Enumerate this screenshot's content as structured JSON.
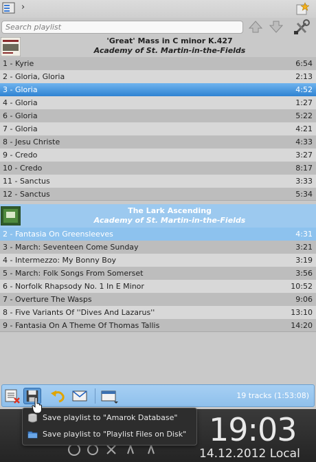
{
  "search": {
    "placeholder": "Search playlist"
  },
  "albums": [
    {
      "title": "'Great' Mass in C minor K.427",
      "artist": "Academy of St. Martin-in-the-Fields",
      "tracks": [
        {
          "name": "1 - Kyrie",
          "time": "6:54"
        },
        {
          "name": "2 - Gloria, Gloria",
          "time": "2:13"
        },
        {
          "name": "3 - Gloria",
          "time": "4:52"
        },
        {
          "name": "4 - Gloria",
          "time": "1:27"
        },
        {
          "name": "6 - Gloria",
          "time": "5:22"
        },
        {
          "name": "7 - Gloria",
          "time": "4:21"
        },
        {
          "name": "8 - Jesu Christe",
          "time": "4:33"
        },
        {
          "name": "9 - Credo",
          "time": "3:27"
        },
        {
          "name": "10 - Credo",
          "time": "8:17"
        },
        {
          "name": "11 - Sanctus",
          "time": "3:33"
        },
        {
          "name": "12 - Sanctus",
          "time": "5:34"
        }
      ]
    },
    {
      "title": "The Lark Ascending",
      "artist": "Academy of St. Martin-in-the-Fields",
      "tracks": [
        {
          "name": "2 - Fantasia On Greensleeves",
          "time": "4:31"
        },
        {
          "name": "3 - March: Seventeen Come Sunday",
          "time": "3:21"
        },
        {
          "name": "4 - Intermezzo: My Bonny Boy",
          "time": "3:19"
        },
        {
          "name": "5 - March: Folk Songs From Somerset",
          "time": "3:56"
        },
        {
          "name": "6 - Norfolk Rhapsody No. 1 In E Minor",
          "time": "10:52"
        },
        {
          "name": "7 - Overture The Wasps",
          "time": "9:06"
        },
        {
          "name": "8 - Five Variants Of ''Dives And Lazarus''",
          "time": "13:10"
        },
        {
          "name": "9 - Fantasia On A Theme Of Thomas Tallis",
          "time": "14:20"
        }
      ]
    }
  ],
  "status": {
    "summary": "19 tracks (1:53:08)"
  },
  "menu": {
    "items": [
      {
        "label": "Save playlist to \"Amarok Database\"",
        "icon": "database-icon"
      },
      {
        "label": "Save playlist to \"Playlist Files on Disk\"",
        "icon": "folder-icon"
      }
    ]
  },
  "desktop": {
    "time": "19:03",
    "date": "14.12.2012 Local"
  },
  "colors": {
    "selection": "#2f83d2",
    "group_selection": "#9cc9ef",
    "toolbar": "#9cc9ef"
  }
}
